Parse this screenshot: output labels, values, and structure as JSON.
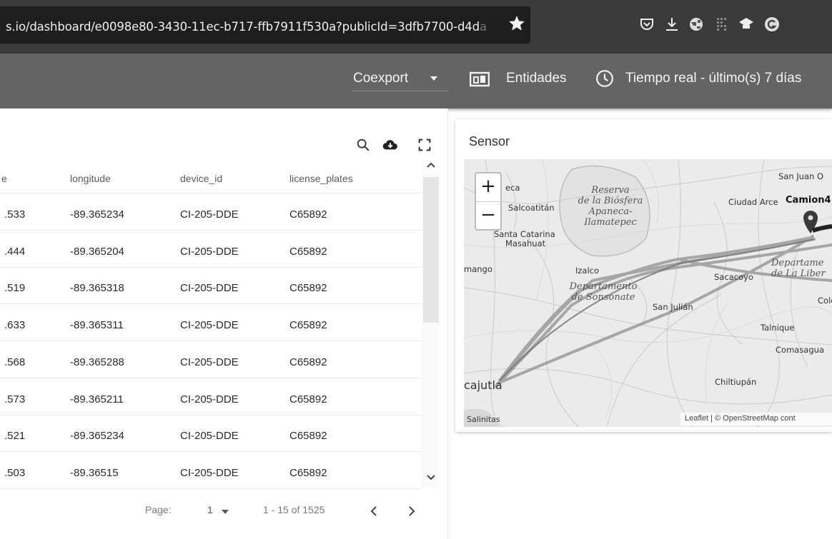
{
  "browser": {
    "url": "s.io/dashboard/e0098e80-3430-11ec-b717-ffb7911f530a?publicId=3dfb7700-d4d",
    "url_tail": "a",
    "extension_icons": [
      "pocket-icon",
      "download-icon",
      "globe-extension-icon",
      "grid-extension-icon",
      "cap-extension-icon",
      "grammarly-icon"
    ]
  },
  "header": {
    "customer_select": "Coexport",
    "entities_label": "Entidades",
    "timewindow_label": "Tiempo real - último(s) 7 días"
  },
  "table": {
    "toolbar_icons": [
      "search-icon",
      "cloud-download-icon",
      "fullscreen-icon"
    ],
    "columns": [
      "longitude",
      "device_id",
      "license_plates"
    ],
    "first_col_header_fragment": "e",
    "rows": [
      {
        "lat": ".533",
        "longitude": "-89.365234",
        "device_id": "CI-205-DDE",
        "license_plates": "C65892"
      },
      {
        "lat": ".444",
        "longitude": "-89.365204",
        "device_id": "CI-205-DDE",
        "license_plates": "C65892"
      },
      {
        "lat": ".519",
        "longitude": "-89.365318",
        "device_id": "CI-205-DDE",
        "license_plates": "C65892"
      },
      {
        "lat": ".633",
        "longitude": "-89.365311",
        "device_id": "CI-205-DDE",
        "license_plates": "C65892"
      },
      {
        "lat": ".568",
        "longitude": "-89.365288",
        "device_id": "CI-205-DDE",
        "license_plates": "C65892"
      },
      {
        "lat": ".573",
        "longitude": "-89.365211",
        "device_id": "CI-205-DDE",
        "license_plates": "C65892"
      },
      {
        "lat": ".521",
        "longitude": "-89.365234",
        "device_id": "CI-205-DDE",
        "license_plates": "C65892"
      },
      {
        "lat": ".503",
        "longitude": "-89.36515",
        "device_id": "CI-205-DDE",
        "license_plates": "C65892"
      }
    ],
    "pagination": {
      "page_label": "Page:",
      "page_value": "1",
      "range": "1 - 15 of 1525"
    }
  },
  "map": {
    "title": "Sensor",
    "zoom_in": "+",
    "zoom_out": "−",
    "attribution": "Leaflet | © OpenStreetMap cont",
    "marker_label": "Camion4",
    "places": {
      "eca": "eca",
      "salcoatitan": "Salcoatitán",
      "santa_catarina": "Santa Catarina",
      "masahuat": "Masahuat",
      "mango": "mango",
      "izalco": "Izalco",
      "sacacoyo": "Sacacoyo",
      "san_julian": "San Julián",
      "san_juan": "San Juan O",
      "ciudad_arce": "Ciudad Arce",
      "colon": "Colo",
      "talnique": "Talnique",
      "comasagua": "Comasagua",
      "chiltiupan": "Chiltiupán",
      "acajutla": "cajutla",
      "salinitas": "Salinitas"
    },
    "regions": {
      "reserva_l1": "Reserva",
      "reserva_l2": "de la Biósfera",
      "reserva_l3": "Apaneca-",
      "reserva_l4": "Ilamatepec",
      "sonsonate_l1": "Departamento",
      "sonsonate_l2": "de Sonsonate",
      "libertad_l1": "Departame",
      "libertad_l2": "de La Liber"
    }
  }
}
